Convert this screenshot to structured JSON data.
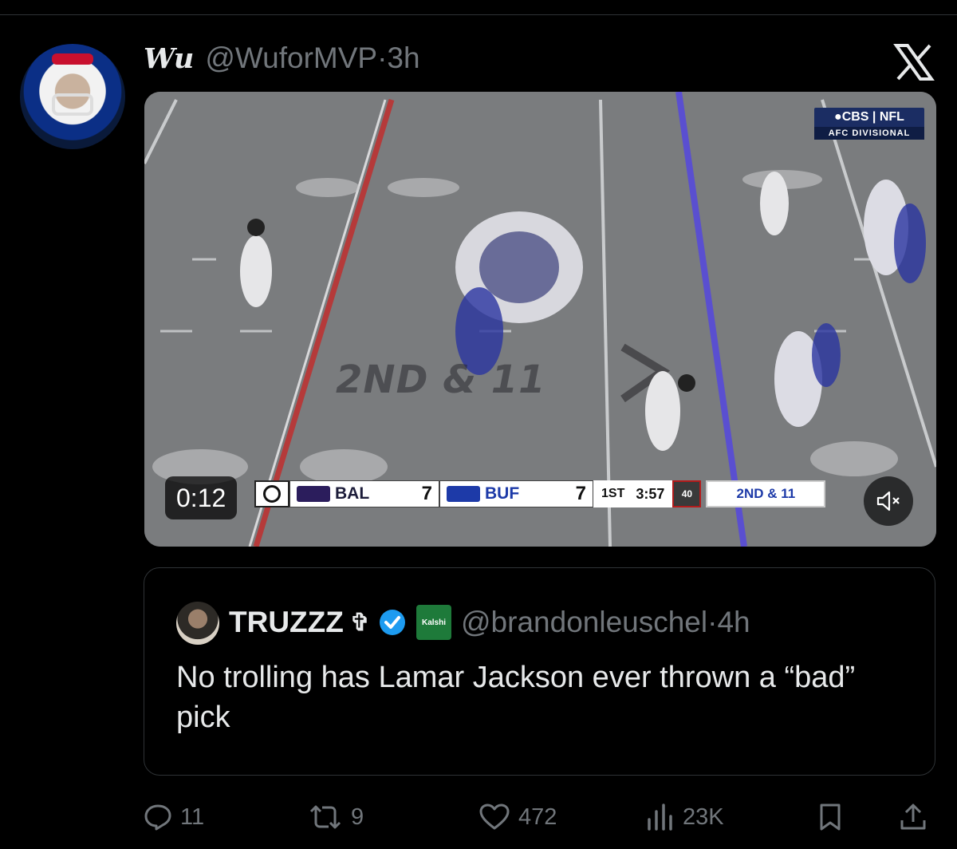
{
  "tweet": {
    "display_name": "Wu",
    "handle": "@WuforMVP",
    "separator": "·",
    "time": "3h"
  },
  "video": {
    "broadcast_tag": "●CBS | NFL",
    "broadcast_subtag": "AFC DIVISIONAL",
    "field_graphic": "2ND & 11",
    "timer": "0:12",
    "muted": true,
    "scorebug": {
      "away_team": "BAL",
      "away_score": "7",
      "home_team": "BUF",
      "home_score": "7",
      "quarter": "1ST",
      "clock": "3:57",
      "play_clock": "40",
      "down_distance": "2ND & 11"
    }
  },
  "quoted": {
    "display_name": "TRUZZZ",
    "cross": "✞",
    "kalshi_label": "Kalshi",
    "handle": "@brandonleuschel",
    "separator": "·",
    "time": "4h",
    "text": "No trolling has Lamar Jackson ever thrown a “bad” pick"
  },
  "actions": {
    "replies": "11",
    "reposts": "9",
    "likes": "472",
    "views": "23K"
  },
  "colors": {
    "background": "#000000",
    "text": "#e7e9ea",
    "muted_text": "#71767b",
    "border": "#2f3336",
    "verified": "#1d9bf0"
  }
}
